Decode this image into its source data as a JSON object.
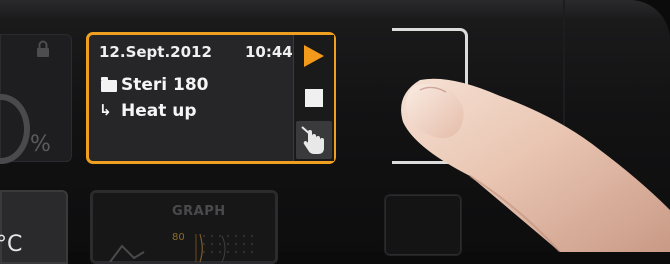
{
  "left_tile": {
    "unit_symbol": "%",
    "lock_icon": "lock-icon"
  },
  "temp_tile": {
    "value": "°C"
  },
  "graph_tile": {
    "title": "GRAPH",
    "axis_value": "80"
  },
  "program_card": {
    "date": "12.Sept.2012",
    "time": "10:44",
    "program_name": "Steri 180",
    "step": "Heat up",
    "step_arrow": "↳",
    "buttons": {
      "play": "play-icon",
      "stop": "stop-icon",
      "touch": "touch-hand-icon"
    }
  },
  "colors": {
    "accent": "#f0a020",
    "play": "#f39a1a",
    "background": "#121213",
    "text": "#f0f0f0"
  }
}
